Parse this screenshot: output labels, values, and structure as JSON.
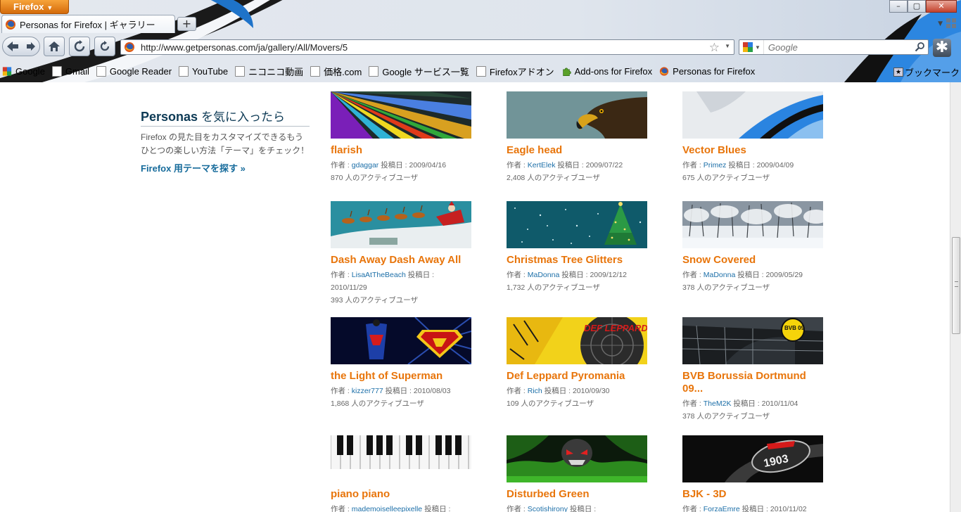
{
  "window": {
    "app_button": "Firefox",
    "controls": [
      "–",
      "▢",
      "✕"
    ]
  },
  "tab": {
    "title": "Personas for Firefox | ギャラリー",
    "new_tab_label": "+"
  },
  "navbar": {
    "url": "http://www.getpersonas.com/ja/gallery/All/Movers/5",
    "search_placeholder": "Google"
  },
  "bookmarks": [
    {
      "label": "Google",
      "icon": "google-icon"
    },
    {
      "label": "Gmail",
      "icon": "page-icon"
    },
    {
      "label": "Google Reader",
      "icon": "page-icon"
    },
    {
      "label": "YouTube",
      "icon": "page-icon"
    },
    {
      "label": "ニコニコ動画",
      "icon": "page-icon"
    },
    {
      "label": "価格.com",
      "icon": "page-icon"
    },
    {
      "label": "Google サービス一覧",
      "icon": "page-icon"
    },
    {
      "label": "Firefoxアドオン",
      "icon": "page-icon"
    },
    {
      "label": "Add-ons for Firefox",
      "icon": "puzzle-icon"
    },
    {
      "label": "Personas for Firefox",
      "icon": "firefox-icon"
    }
  ],
  "bookmarks_menu": "ブックマーク",
  "sidebar": {
    "title_brand": "Personas",
    "title_suffix": "を気に入ったら",
    "description": "Firefox の見た目をカスタマイズできるもうひとつの楽しい方法「テーマ」をチェック！",
    "link": "Firefox 用テーマを探す »"
  },
  "labels": {
    "author_prefix": "作者 : ",
    "posted_prefix": " 投稿日 : ",
    "users_suffix": " 人のアクティブユーザ"
  },
  "personas": [
    {
      "title": "flarish",
      "author": "gdaggar",
      "date": "2009/04/16",
      "users": "870",
      "thumb": "flarish"
    },
    {
      "title": "Eagle head",
      "author": "KertElek",
      "date": "2009/07/22",
      "users": "2,408",
      "thumb": "eagle"
    },
    {
      "title": "Vector Blues",
      "author": "Primez",
      "date": "2009/04/09",
      "users": "675",
      "thumb": "vector"
    },
    {
      "title": "Dash Away Dash Away All",
      "author": "LisaAtTheBeach",
      "date": "2010/11/29",
      "users": "393",
      "thumb": "dash"
    },
    {
      "title": "Christmas Tree Glitters",
      "author": "MaDonna",
      "date": "2009/12/12",
      "users": "1,732",
      "thumb": "xmas"
    },
    {
      "title": "Snow Covered",
      "author": "MaDonna",
      "date": "2009/05/29",
      "users": "378",
      "thumb": "snow"
    },
    {
      "title": "the Light of Superman",
      "author": "kizzer777",
      "date": "2010/08/03",
      "users": "1,868",
      "thumb": "superman"
    },
    {
      "title": "Def Leppard Pyromania",
      "author": "Rich",
      "date": "2010/09/30",
      "users": "109",
      "thumb": "defleppard"
    },
    {
      "title": "BVB Borussia Dortmund 09...",
      "author": "TheM2K",
      "date": "2010/11/04",
      "users": "378",
      "thumb": "bvb"
    },
    {
      "title": "piano piano",
      "author": "mademoiselleepixelle",
      "date": "",
      "users": "",
      "thumb": "piano"
    },
    {
      "title": "Disturbed Green",
      "author": "Scotishirony",
      "date": "",
      "users": "",
      "thumb": "disturbed"
    },
    {
      "title": "BJK - 3D",
      "author": "ForzaEmre",
      "date": "2010/11/02",
      "users": "",
      "thumb": "bjk"
    }
  ],
  "thumb_texts": {
    "defleppard": "DEF LEPPARD",
    "bvb": "BVB 09",
    "bjk": "1903"
  },
  "colors": {
    "title_orange": "#e8750b",
    "link_blue": "#1c6fa8",
    "sidebar_title": "#0d3a55"
  }
}
